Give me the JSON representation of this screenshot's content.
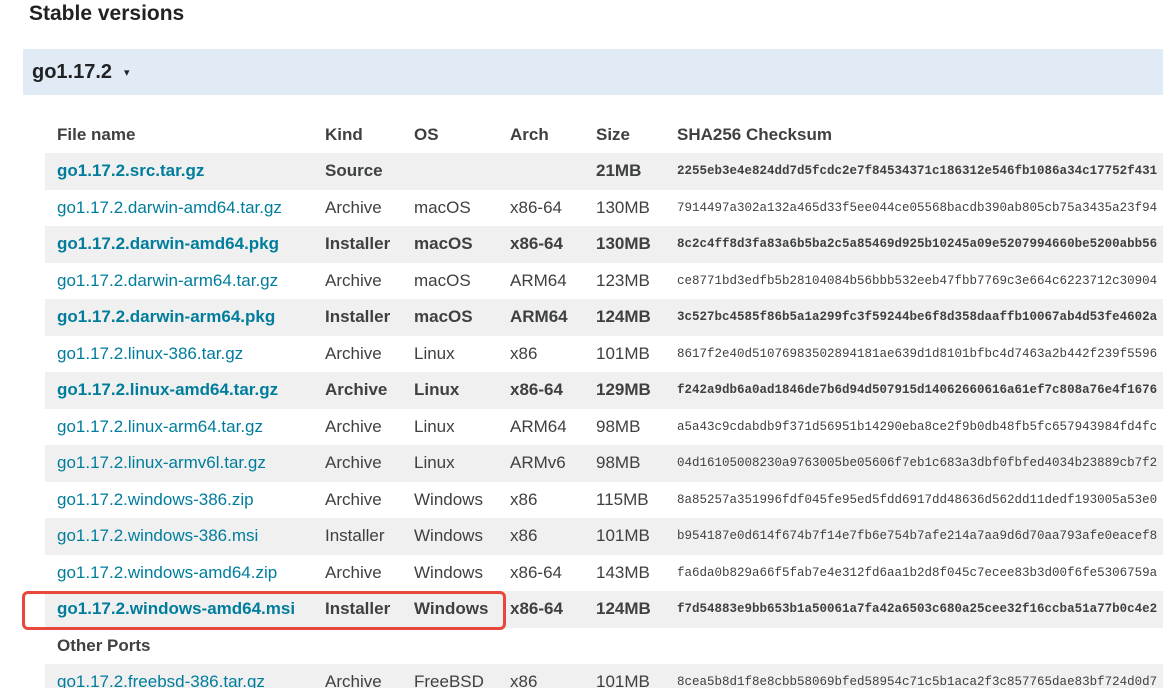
{
  "section_title": "Stable versions",
  "release": {
    "version": "go1.17.2",
    "caret": "▾"
  },
  "columns": [
    "File name",
    "Kind",
    "OS",
    "Arch",
    "Size",
    "SHA256 Checksum"
  ],
  "rows": [
    {
      "file": "go1.17.2.src.tar.gz",
      "kind": "Source",
      "os": "",
      "arch": "",
      "size": "21MB",
      "sha": "2255eb3e4e824dd7d5fcdc2e7f84534371c186312e546fb1086a34c17752f431",
      "featured": true
    },
    {
      "file": "go1.17.2.darwin-amd64.tar.gz",
      "kind": "Archive",
      "os": "macOS",
      "arch": "x86-64",
      "size": "130MB",
      "sha": "7914497a302a132a465d33f5ee044ce05568bacdb390ab805cb75a3435a23f94",
      "featured": false
    },
    {
      "file": "go1.17.2.darwin-amd64.pkg",
      "kind": "Installer",
      "os": "macOS",
      "arch": "x86-64",
      "size": "130MB",
      "sha": "8c2c4ff8d3fa83a6b5ba2c5a85469d925b10245a09e5207994660be5200abb56",
      "featured": true
    },
    {
      "file": "go1.17.2.darwin-arm64.tar.gz",
      "kind": "Archive",
      "os": "macOS",
      "arch": "ARM64",
      "size": "123MB",
      "sha": "ce8771bd3edfb5b28104084b56bbb532eeb47fbb7769c3e664c6223712c30904",
      "featured": false
    },
    {
      "file": "go1.17.2.darwin-arm64.pkg",
      "kind": "Installer",
      "os": "macOS",
      "arch": "ARM64",
      "size": "124MB",
      "sha": "3c527bc4585f86b5a1a299fc3f59244be6f8d358daaffb10067ab4d53fe4602a",
      "featured": true
    },
    {
      "file": "go1.17.2.linux-386.tar.gz",
      "kind": "Archive",
      "os": "Linux",
      "arch": "x86",
      "size": "101MB",
      "sha": "8617f2e40d51076983502894181ae639d1d8101bfbc4d7463a2b442f239f5596",
      "featured": false
    },
    {
      "file": "go1.17.2.linux-amd64.tar.gz",
      "kind": "Archive",
      "os": "Linux",
      "arch": "x86-64",
      "size": "129MB",
      "sha": "f242a9db6a0ad1846de7b6d94d507915d14062660616a61ef7c808a76e4f1676",
      "featured": true
    },
    {
      "file": "go1.17.2.linux-arm64.tar.gz",
      "kind": "Archive",
      "os": "Linux",
      "arch": "ARM64",
      "size": "98MB",
      "sha": "a5a43c9cdabdb9f371d56951b14290eba8ce2f9b0db48fb5fc657943984fd4fc",
      "featured": false
    },
    {
      "file": "go1.17.2.linux-armv6l.tar.gz",
      "kind": "Archive",
      "os": "Linux",
      "arch": "ARMv6",
      "size": "98MB",
      "sha": "04d16105008230a9763005be05606f7eb1c683a3dbf0fbfed4034b23889cb7f2",
      "featured": false
    },
    {
      "file": "go1.17.2.windows-386.zip",
      "kind": "Archive",
      "os": "Windows",
      "arch": "x86",
      "size": "115MB",
      "sha": "8a85257a351996fdf045fe95ed5fdd6917dd48636d562dd11dedf193005a53e0",
      "featured": false
    },
    {
      "file": "go1.17.2.windows-386.msi",
      "kind": "Installer",
      "os": "Windows",
      "arch": "x86",
      "size": "101MB",
      "sha": "b954187e0d614f674b7f14e7fb6e754b7afe214a7aa9d6d70aa793afe0eacef8",
      "featured": false
    },
    {
      "file": "go1.17.2.windows-amd64.zip",
      "kind": "Archive",
      "os": "Windows",
      "arch": "x86-64",
      "size": "143MB",
      "sha": "fa6da0b829a66f5fab7e4e312fd6aa1b2d8f045c7ecee83b3d00f6fe5306759a",
      "featured": false
    },
    {
      "file": "go1.17.2.windows-amd64.msi",
      "kind": "Installer",
      "os": "Windows",
      "arch": "x86-64",
      "size": "124MB",
      "sha": "f7d54883e9bb653b1a50061a7fa42a6503c680a25cee32f16ccba51a77b0c4e2",
      "featured": true
    }
  ],
  "other_ports_label": "Other Ports",
  "other_rows": [
    {
      "file": "go1.17.2.freebsd-386.tar.gz",
      "kind": "Archive",
      "os": "FreeBSD",
      "arch": "x86",
      "size": "101MB",
      "sha": "8cea5b8d1f8e8cbb58069bfed58954c71c5b1aca2f3c857765dae83bf724d0d7"
    }
  ],
  "colors": {
    "link": "#007d9c",
    "header_bar": "#e0ebf5",
    "stripe": "#f0f0f0",
    "highlight_box": "#e8483b"
  }
}
